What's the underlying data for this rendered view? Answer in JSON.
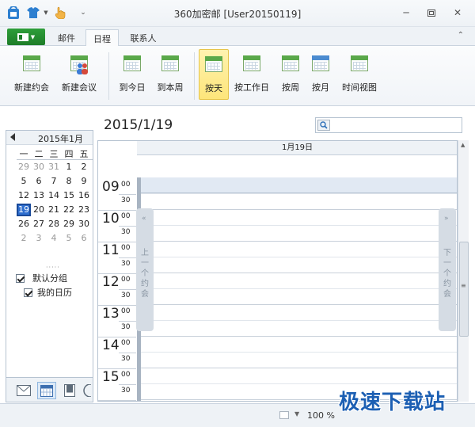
{
  "window": {
    "title": "360加密邮 [User20150119]"
  },
  "tabs": [
    {
      "label": "邮件"
    },
    {
      "label": "日程"
    },
    {
      "label": "联系人"
    }
  ],
  "ribbon": {
    "buttons": [
      {
        "label": "新建约会",
        "icon": "new-appointment-icon"
      },
      {
        "label": "新建会议",
        "icon": "new-meeting-icon"
      },
      {
        "label": "到今日",
        "icon": "go-today-icon"
      },
      {
        "label": "到本周",
        "icon": "go-this-week-icon"
      },
      {
        "label": "按天",
        "icon": "day-view-icon"
      },
      {
        "label": "按工作日",
        "icon": "workweek-view-icon"
      },
      {
        "label": "按周",
        "icon": "week-view-icon"
      },
      {
        "label": "按月",
        "icon": "month-view-icon"
      },
      {
        "label": "时间视图",
        "icon": "timeline-view-icon"
      }
    ]
  },
  "mini_calendar": {
    "title": "2015年1月",
    "weekdays": [
      "一",
      "二",
      "三",
      "四",
      "五"
    ],
    "weeks": [
      [
        "29",
        "30",
        "31",
        "1",
        "2"
      ],
      [
        "5",
        "6",
        "7",
        "8",
        "9"
      ],
      [
        "12",
        "13",
        "14",
        "15",
        "16"
      ],
      [
        "19",
        "20",
        "21",
        "22",
        "23"
      ],
      [
        "26",
        "27",
        "28",
        "29",
        "30"
      ],
      [
        "2",
        "3",
        "4",
        "5",
        "6"
      ]
    ],
    "today": "19"
  },
  "groups": {
    "group_label": "默认分组",
    "calendar_label": "我的日历"
  },
  "main": {
    "date_title": "2015/1/19",
    "column_header": "1月19日",
    "hours": [
      "09",
      "10",
      "11",
      "12",
      "13",
      "14",
      "15"
    ],
    "min_00": "00",
    "min_30": "30",
    "prev_tab": "上一个约会",
    "next_tab": "下一个约会"
  },
  "status": {
    "zoom": "100 %"
  },
  "watermark": "极速下载站",
  "colors": {
    "accent_green": "#1d7d28",
    "selected_button": "#fde57a",
    "today_blue": "#2f6fcf",
    "watermark_blue": "#1c5fb3"
  }
}
